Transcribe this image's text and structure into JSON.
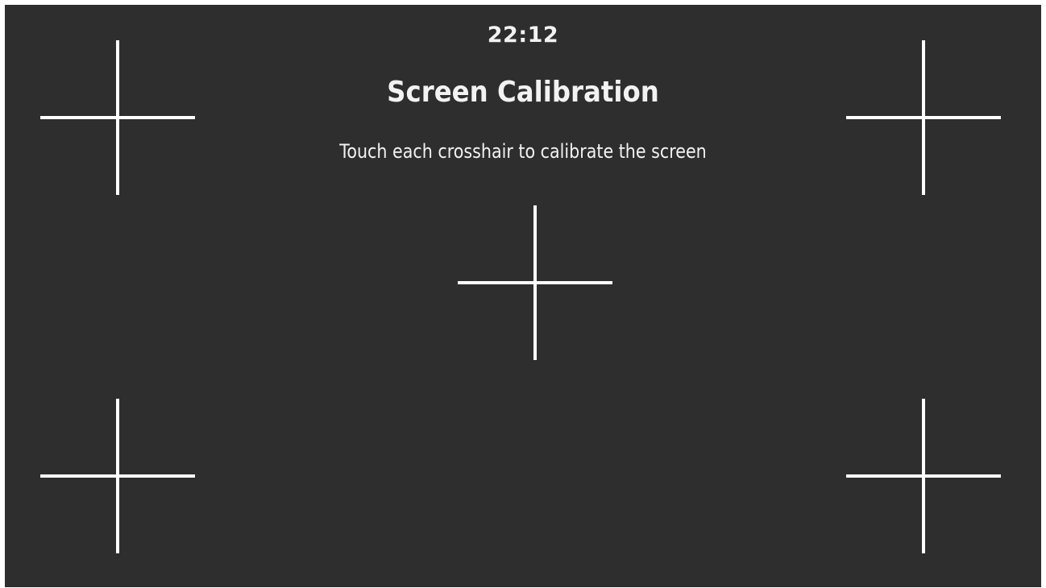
{
  "status": {
    "time": "22:12"
  },
  "calibration": {
    "title": "Screen Calibration",
    "instruction": "Touch each crosshair to calibrate the screen"
  },
  "crosshairs": [
    {
      "name": "top-left"
    },
    {
      "name": "top-right"
    },
    {
      "name": "center"
    },
    {
      "name": "bottom-left"
    },
    {
      "name": "bottom-right"
    }
  ],
  "colors": {
    "background": "#2e2e2e",
    "foreground": "#ffffff"
  }
}
